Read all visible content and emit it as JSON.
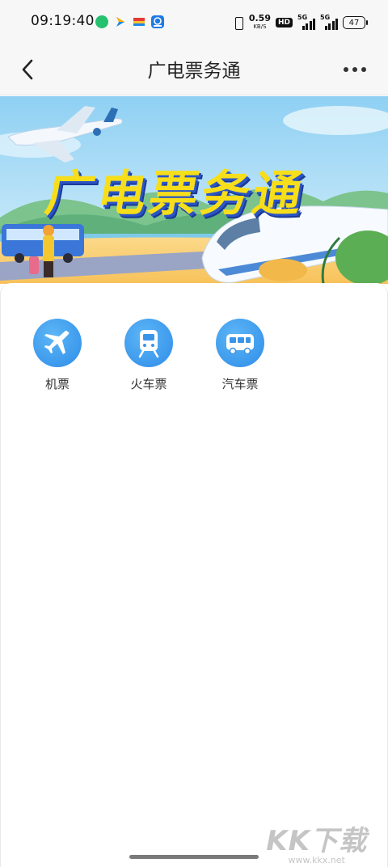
{
  "status_bar": {
    "time": "09:19:40",
    "net_speed_value": "0.59",
    "net_speed_unit": "KB/S",
    "hd_label": "HD",
    "signal1_label": "5G",
    "signal2_label": "5G",
    "battery": "47"
  },
  "nav": {
    "title": "广电票务通",
    "back_icon": "chevron-left-icon",
    "more_icon": "more-horizontal-icon"
  },
  "banner": {
    "title": "广电票务通"
  },
  "services": [
    {
      "label": "机票",
      "icon": "airplane-icon"
    },
    {
      "label": "火车票",
      "icon": "train-icon"
    },
    {
      "label": "汽车票",
      "icon": "bus-icon"
    }
  ],
  "watermark": {
    "main": "KK下载",
    "url": "www.kkx.net"
  },
  "colors": {
    "accent_blue": "#2e8ce8",
    "banner_yellow": "#f7de1a",
    "page_bg": "#ffffff",
    "bar_bg": "#f7f7f7"
  }
}
